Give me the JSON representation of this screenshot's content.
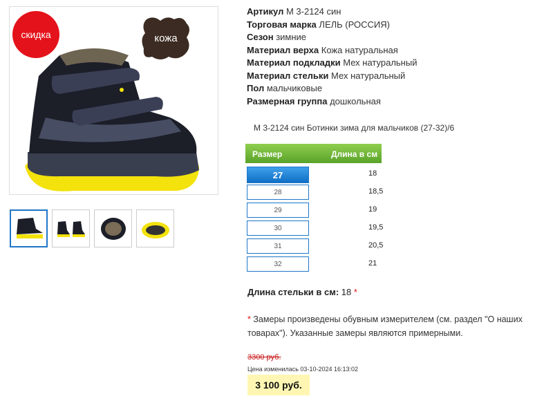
{
  "badges": {
    "sale": "скидка",
    "leather": "кожа"
  },
  "specs": [
    {
      "label": "Артикул",
      "value": "М 3-2124 син"
    },
    {
      "label": "Торговая марка",
      "value": "ЛЕЛЬ (РОССИЯ)"
    },
    {
      "label": "Сезон",
      "value": "зимние"
    },
    {
      "label": "Материал верха",
      "value": "Кожа натуральная"
    },
    {
      "label": "Материал подкладки",
      "value": "Мех натуральный"
    },
    {
      "label": "Материал стельки",
      "value": "Мех натуральный"
    },
    {
      "label": "Пол",
      "value": "мальчиковые"
    },
    {
      "label": "Размерная группа",
      "value": "дошкольная"
    }
  ],
  "description": "М 3-2124 син Ботинки зима для мальчиков (27-32)/6",
  "size_table": {
    "header_size": "Размер",
    "header_length": "Длина в см",
    "rows": [
      {
        "size": "27",
        "length": "18",
        "selected": true
      },
      {
        "size": "28",
        "length": "18,5",
        "selected": false
      },
      {
        "size": "29",
        "length": "19",
        "selected": false
      },
      {
        "size": "30",
        "length": "19,5",
        "selected": false
      },
      {
        "size": "31",
        "length": "20,5",
        "selected": false
      },
      {
        "size": "32",
        "length": "21",
        "selected": false
      }
    ]
  },
  "insole": {
    "label": "Длина стельки в см:",
    "value": "18",
    "star": "*"
  },
  "note": {
    "star": "*",
    "text_before": " Замеры произведены обувным измерителем (см. ",
    "link": "раздел \"О наших товарах\"",
    "text_after": "). Указанные замеры являются примерными."
  },
  "price": {
    "old": "3300 руб.",
    "changed": "Цена изменилась 03-10-2024 16:13:02",
    "current": "3 100 руб."
  },
  "colors": {
    "accent": "#1e75c8",
    "sale": "#e4121a",
    "table_header": "#6db33a",
    "price_bg": "#fff6b3"
  }
}
